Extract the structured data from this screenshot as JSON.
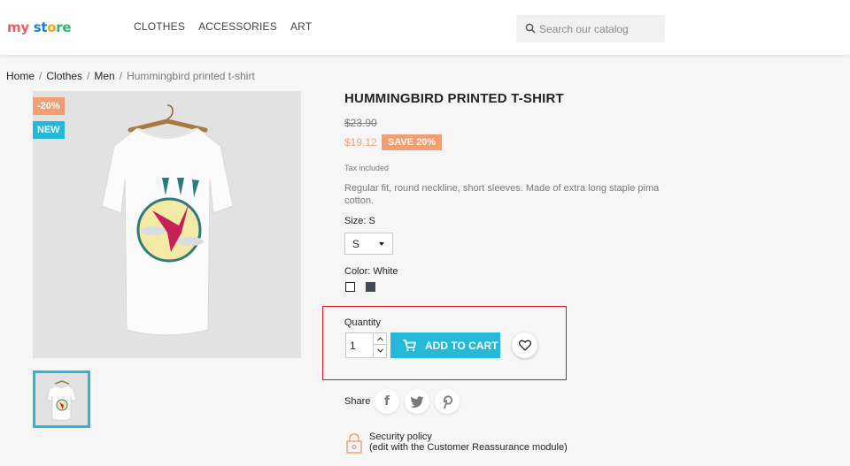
{
  "header": {
    "logo": {
      "part1": "my",
      "part2": " st",
      "part3": "o",
      "part4": "re"
    },
    "nav": [
      "CLOTHES",
      "ACCESSORIES",
      "ART"
    ],
    "search": {
      "placeholder": "Search our catalog",
      "icon": "search-icon"
    }
  },
  "breadcrumb": [
    "Home",
    "Clothes",
    "Men",
    "Hummingbird printed t-shirt"
  ],
  "product": {
    "flags": {
      "discount": "-20%",
      "new": "NEW"
    },
    "title": "HUMMINGBIRD PRINTED T-SHIRT",
    "old_price": "$23.90",
    "price": "$19.12",
    "save_badge": "SAVE 20%",
    "tax": "Tax included",
    "description": "Regular fit, round neckline, short sleeves. Made of extra long staple pima cotton.",
    "size_label": "Size: S",
    "size_value": "S",
    "color_label": "Color: White",
    "colors": [
      "#ffffff",
      "#434a54"
    ],
    "quantity_label": "Quantity",
    "quantity_value": "1",
    "add_to_cart": "ADD TO CART",
    "share_label": "Share",
    "social_icons": [
      "facebook-icon",
      "twitter-icon",
      "pinterest-icon"
    ],
    "security_title": "Security policy",
    "security_sub": "(edit with the Customer Reassurance module)"
  },
  "colors": {
    "accent": "#24b9d7",
    "discount": "#f39d72",
    "highlight": "#e0141b"
  }
}
